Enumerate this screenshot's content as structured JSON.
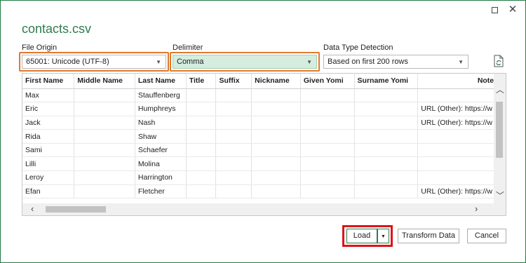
{
  "window": {
    "title": "contacts.csv",
    "maximize_label": "",
    "close_label": "✕"
  },
  "file_origin": {
    "label": "File Origin",
    "value": "65001: Unicode (UTF-8)"
  },
  "delimiter": {
    "label": "Delimiter",
    "value": "Comma"
  },
  "data_type_detection": {
    "label": "Data Type Detection",
    "value": "Based on first 200 rows"
  },
  "table": {
    "columns": [
      "First Name",
      "Middle Name",
      "Last Name",
      "Title",
      "Suffix",
      "Nickname",
      "Given Yomi",
      "Surname Yomi",
      "Notes"
    ],
    "rows": [
      [
        "Max",
        "",
        "Stauffenberg",
        "",
        "",
        "",
        "",
        "",
        ""
      ],
      [
        "Eric",
        "",
        "Humphreys",
        "",
        "",
        "",
        "",
        "",
        "URL (Other): https://w"
      ],
      [
        "Jack",
        "",
        "Nash",
        "",
        "",
        "",
        "",
        "",
        "URL (Other): https://w"
      ],
      [
        "Rida",
        "",
        "Shaw",
        "",
        "",
        "",
        "",
        "",
        ""
      ],
      [
        "Sami",
        "",
        "Schaefer",
        "",
        "",
        "",
        "",
        "",
        ""
      ],
      [
        "Lilli",
        "",
        "Molina",
        "",
        "",
        "",
        "",
        "",
        ""
      ],
      [
        "Leroy",
        "",
        "Harrington",
        "",
        "",
        "",
        "",
        "",
        ""
      ],
      [
        "Efan",
        "",
        "Fletcher",
        "",
        "",
        "",
        "",
        "",
        "URL (Other): https://w"
      ]
    ]
  },
  "buttons": {
    "load": "Load",
    "transform": "Transform Data",
    "cancel": "Cancel"
  },
  "colors": {
    "accent": "#2e7b4f",
    "highlight_orange": "#e07b2e",
    "highlight_red": "#e0121b",
    "delimiter_bg": "#d4edde"
  }
}
